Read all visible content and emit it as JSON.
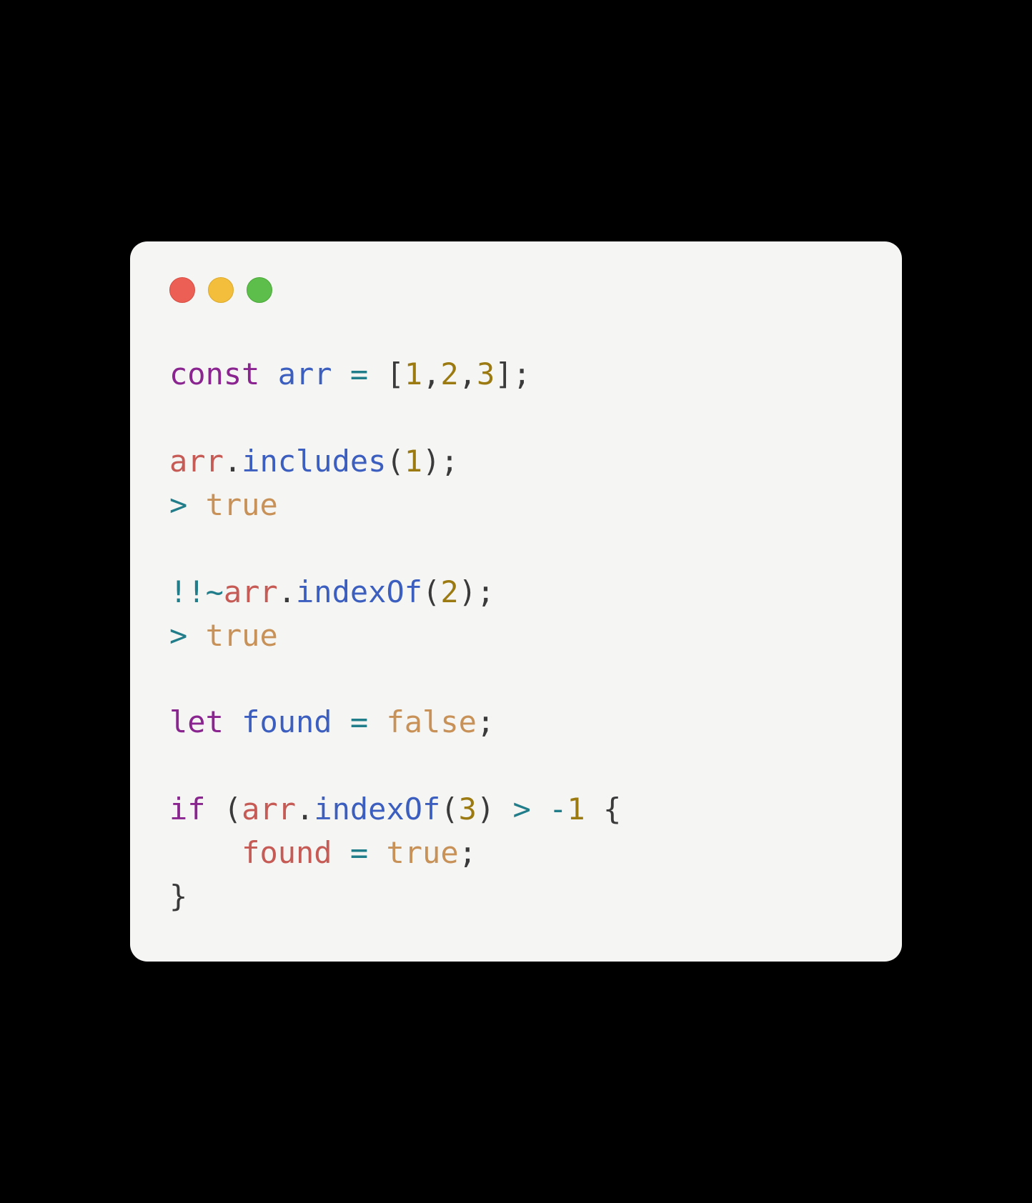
{
  "colors": {
    "background": "#000000",
    "window_bg": "#f5f5f4",
    "traffic_red": "#ec5f55",
    "traffic_yellow": "#f2be3c",
    "traffic_green": "#5ebe4c",
    "keyword": "#8a2590",
    "variable": "#c65a54",
    "method": "#3c5fbf",
    "number": "#9b7a12",
    "boolean": "#c79157",
    "operator": "#207d89",
    "punctuation": "#3a3a3a"
  },
  "code": {
    "lines": [
      [
        {
          "cls": "tok-keyword",
          "t": "const"
        },
        {
          "cls": "",
          "t": " "
        },
        {
          "cls": "tok-method",
          "t": "arr"
        },
        {
          "cls": "",
          "t": " "
        },
        {
          "cls": "tok-op",
          "t": "="
        },
        {
          "cls": "",
          "t": " "
        },
        {
          "cls": "tok-punct",
          "t": "["
        },
        {
          "cls": "tok-number",
          "t": "1"
        },
        {
          "cls": "tok-punct",
          "t": ","
        },
        {
          "cls": "tok-number",
          "t": "2"
        },
        {
          "cls": "tok-punct",
          "t": ","
        },
        {
          "cls": "tok-number",
          "t": "3"
        },
        {
          "cls": "tok-punct",
          "t": "];"
        }
      ],
      [],
      [
        {
          "cls": "tok-var",
          "t": "arr"
        },
        {
          "cls": "tok-punct",
          "t": "."
        },
        {
          "cls": "tok-method",
          "t": "includes"
        },
        {
          "cls": "tok-punct",
          "t": "("
        },
        {
          "cls": "tok-number",
          "t": "1"
        },
        {
          "cls": "tok-punct",
          "t": ");"
        }
      ],
      [
        {
          "cls": "tok-prompt",
          "t": ">"
        },
        {
          "cls": "",
          "t": " "
        },
        {
          "cls": "tok-bool",
          "t": "true"
        }
      ],
      [],
      [
        {
          "cls": "tok-op",
          "t": "!!~"
        },
        {
          "cls": "tok-var",
          "t": "arr"
        },
        {
          "cls": "tok-punct",
          "t": "."
        },
        {
          "cls": "tok-method",
          "t": "indexOf"
        },
        {
          "cls": "tok-punct",
          "t": "("
        },
        {
          "cls": "tok-number",
          "t": "2"
        },
        {
          "cls": "tok-punct",
          "t": ");"
        }
      ],
      [
        {
          "cls": "tok-prompt",
          "t": ">"
        },
        {
          "cls": "",
          "t": " "
        },
        {
          "cls": "tok-bool",
          "t": "true"
        }
      ],
      [],
      [
        {
          "cls": "tok-keyword",
          "t": "let"
        },
        {
          "cls": "",
          "t": " "
        },
        {
          "cls": "tok-method",
          "t": "found"
        },
        {
          "cls": "",
          "t": " "
        },
        {
          "cls": "tok-op",
          "t": "="
        },
        {
          "cls": "",
          "t": " "
        },
        {
          "cls": "tok-bool",
          "t": "false"
        },
        {
          "cls": "tok-punct",
          "t": ";"
        }
      ],
      [],
      [
        {
          "cls": "tok-keyword",
          "t": "if"
        },
        {
          "cls": "",
          "t": " "
        },
        {
          "cls": "tok-punct",
          "t": "("
        },
        {
          "cls": "tok-var",
          "t": "arr"
        },
        {
          "cls": "tok-punct",
          "t": "."
        },
        {
          "cls": "tok-method",
          "t": "indexOf"
        },
        {
          "cls": "tok-punct",
          "t": "("
        },
        {
          "cls": "tok-number",
          "t": "3"
        },
        {
          "cls": "tok-punct",
          "t": ")"
        },
        {
          "cls": "",
          "t": " "
        },
        {
          "cls": "tok-op",
          "t": ">"
        },
        {
          "cls": "",
          "t": " "
        },
        {
          "cls": "tok-op",
          "t": "-"
        },
        {
          "cls": "tok-number",
          "t": "1"
        },
        {
          "cls": "",
          "t": " "
        },
        {
          "cls": "tok-punct",
          "t": "{"
        }
      ],
      [
        {
          "cls": "",
          "t": "    "
        },
        {
          "cls": "tok-var",
          "t": "found"
        },
        {
          "cls": "",
          "t": " "
        },
        {
          "cls": "tok-op",
          "t": "="
        },
        {
          "cls": "",
          "t": " "
        },
        {
          "cls": "tok-bool",
          "t": "true"
        },
        {
          "cls": "tok-punct",
          "t": ";"
        }
      ],
      [
        {
          "cls": "tok-punct",
          "t": "}"
        }
      ]
    ]
  }
}
